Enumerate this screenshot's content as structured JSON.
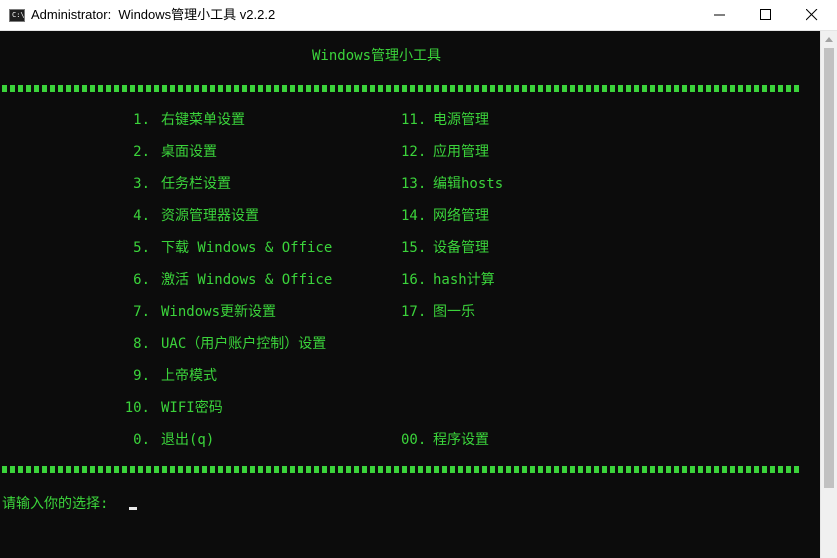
{
  "window": {
    "title": "Administrator:  Windows管理小工具 v2.2.2",
    "icon_name": "cmd-icon",
    "icon_text": "C:\\",
    "controls": [
      "minimize-icon",
      "maximize-icon",
      "close-icon"
    ]
  },
  "console": {
    "header": "Windows管理小工具",
    "separator": "==================================================================================================",
    "left_menu": [
      {
        "num": "1.",
        "label": "右键菜单设置"
      },
      {
        "num": "2.",
        "label": "桌面设置"
      },
      {
        "num": "3.",
        "label": "任务栏设置"
      },
      {
        "num": "4.",
        "label": "资源管理器设置"
      },
      {
        "num": "5.",
        "label": "下载 Windows & Office"
      },
      {
        "num": "6.",
        "label": "激活 Windows & Office"
      },
      {
        "num": "7.",
        "label": "Windows更新设置"
      },
      {
        "num": "8.",
        "label": "UAC（用户账户控制）设置"
      },
      {
        "num": "9.",
        "label": "上帝模式"
      },
      {
        "num": "10.",
        "label": "WIFI密码"
      },
      {
        "num": "0.",
        "label": "退出(q)"
      }
    ],
    "right_menu": [
      {
        "num": "11.",
        "label": "电源管理"
      },
      {
        "num": "12.",
        "label": "应用管理"
      },
      {
        "num": "13.",
        "label": "编辑hosts"
      },
      {
        "num": "14.",
        "label": "网络管理"
      },
      {
        "num": "15.",
        "label": "设备管理"
      },
      {
        "num": "16.",
        "label": "hash计算"
      },
      {
        "num": "17.",
        "label": "图一乐"
      },
      {
        "num": "00.",
        "label": "程序设置"
      }
    ],
    "prompt": "请输入你的选择: "
  },
  "colors": {
    "console_bg": "#0c0c0c",
    "console_text": "#3bd43b",
    "titlebar_bg": "#ffffff"
  }
}
